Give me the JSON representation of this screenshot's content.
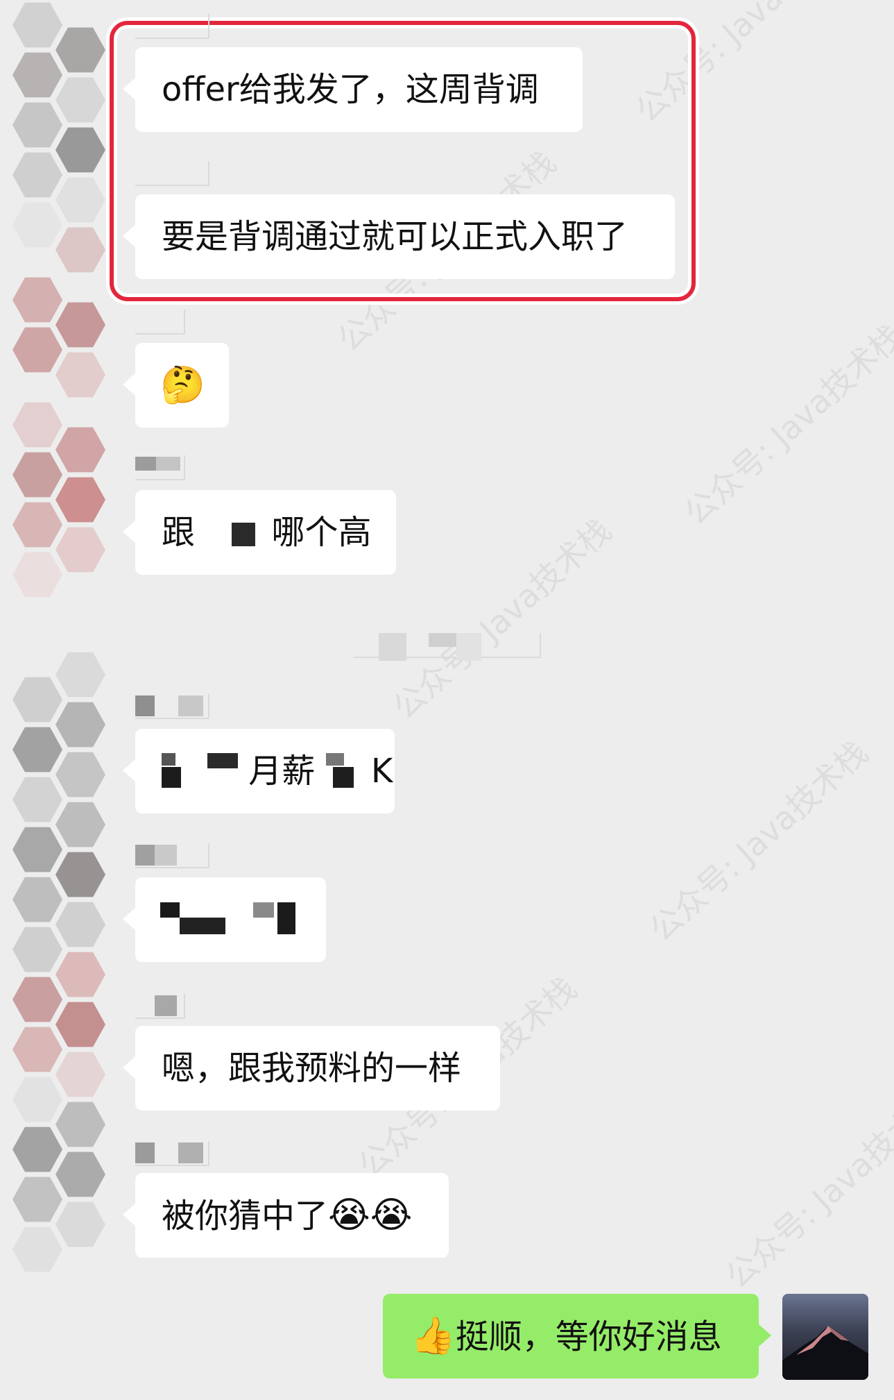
{
  "messages": [
    {
      "text": "offer给我发了，这周背调"
    },
    {
      "text": "要是背调通过就可以正式入职了"
    },
    {
      "emoji": "🤔"
    },
    {
      "text_a": "跟",
      "text_b": "哪个高"
    },
    {
      "text_a": "月薪",
      "text_b": "K"
    },
    {
      "text": ""
    },
    {
      "text": "嗯，跟我预料的一样"
    },
    {
      "text": "被你猜中了",
      "emoji": "😭😭"
    }
  ],
  "my_message": {
    "thumb": "👍",
    "text": "挺顺，等你好消息"
  },
  "watermark": {
    "text": "公众号: Java技术栈"
  },
  "colors": {
    "background": "#ededed",
    "bubble": "#ffffff",
    "my_bubble": "#95ec69",
    "highlight": "#e3263c"
  }
}
